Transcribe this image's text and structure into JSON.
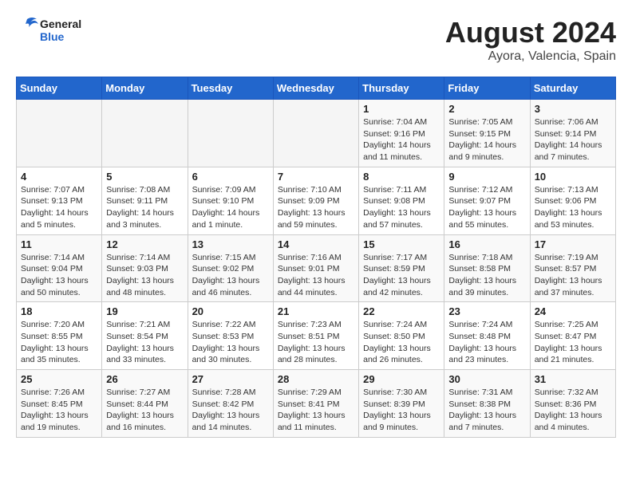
{
  "logo": {
    "line1": "General",
    "line2": "Blue"
  },
  "title": "August 2024",
  "subtitle": "Ayora, Valencia, Spain",
  "weekdays": [
    "Sunday",
    "Monday",
    "Tuesday",
    "Wednesday",
    "Thursday",
    "Friday",
    "Saturday"
  ],
  "weeks": [
    [
      {
        "day": "",
        "info": ""
      },
      {
        "day": "",
        "info": ""
      },
      {
        "day": "",
        "info": ""
      },
      {
        "day": "",
        "info": ""
      },
      {
        "day": "1",
        "info": "Sunrise: 7:04 AM\nSunset: 9:16 PM\nDaylight: 14 hours\nand 11 minutes."
      },
      {
        "day": "2",
        "info": "Sunrise: 7:05 AM\nSunset: 9:15 PM\nDaylight: 14 hours\nand 9 minutes."
      },
      {
        "day": "3",
        "info": "Sunrise: 7:06 AM\nSunset: 9:14 PM\nDaylight: 14 hours\nand 7 minutes."
      }
    ],
    [
      {
        "day": "4",
        "info": "Sunrise: 7:07 AM\nSunset: 9:13 PM\nDaylight: 14 hours\nand 5 minutes."
      },
      {
        "day": "5",
        "info": "Sunrise: 7:08 AM\nSunset: 9:11 PM\nDaylight: 14 hours\nand 3 minutes."
      },
      {
        "day": "6",
        "info": "Sunrise: 7:09 AM\nSunset: 9:10 PM\nDaylight: 14 hours\nand 1 minute."
      },
      {
        "day": "7",
        "info": "Sunrise: 7:10 AM\nSunset: 9:09 PM\nDaylight: 13 hours\nand 59 minutes."
      },
      {
        "day": "8",
        "info": "Sunrise: 7:11 AM\nSunset: 9:08 PM\nDaylight: 13 hours\nand 57 minutes."
      },
      {
        "day": "9",
        "info": "Sunrise: 7:12 AM\nSunset: 9:07 PM\nDaylight: 13 hours\nand 55 minutes."
      },
      {
        "day": "10",
        "info": "Sunrise: 7:13 AM\nSunset: 9:06 PM\nDaylight: 13 hours\nand 53 minutes."
      }
    ],
    [
      {
        "day": "11",
        "info": "Sunrise: 7:14 AM\nSunset: 9:04 PM\nDaylight: 13 hours\nand 50 minutes."
      },
      {
        "day": "12",
        "info": "Sunrise: 7:14 AM\nSunset: 9:03 PM\nDaylight: 13 hours\nand 48 minutes."
      },
      {
        "day": "13",
        "info": "Sunrise: 7:15 AM\nSunset: 9:02 PM\nDaylight: 13 hours\nand 46 minutes."
      },
      {
        "day": "14",
        "info": "Sunrise: 7:16 AM\nSunset: 9:01 PM\nDaylight: 13 hours\nand 44 minutes."
      },
      {
        "day": "15",
        "info": "Sunrise: 7:17 AM\nSunset: 8:59 PM\nDaylight: 13 hours\nand 42 minutes."
      },
      {
        "day": "16",
        "info": "Sunrise: 7:18 AM\nSunset: 8:58 PM\nDaylight: 13 hours\nand 39 minutes."
      },
      {
        "day": "17",
        "info": "Sunrise: 7:19 AM\nSunset: 8:57 PM\nDaylight: 13 hours\nand 37 minutes."
      }
    ],
    [
      {
        "day": "18",
        "info": "Sunrise: 7:20 AM\nSunset: 8:55 PM\nDaylight: 13 hours\nand 35 minutes."
      },
      {
        "day": "19",
        "info": "Sunrise: 7:21 AM\nSunset: 8:54 PM\nDaylight: 13 hours\nand 33 minutes."
      },
      {
        "day": "20",
        "info": "Sunrise: 7:22 AM\nSunset: 8:53 PM\nDaylight: 13 hours\nand 30 minutes."
      },
      {
        "day": "21",
        "info": "Sunrise: 7:23 AM\nSunset: 8:51 PM\nDaylight: 13 hours\nand 28 minutes."
      },
      {
        "day": "22",
        "info": "Sunrise: 7:24 AM\nSunset: 8:50 PM\nDaylight: 13 hours\nand 26 minutes."
      },
      {
        "day": "23",
        "info": "Sunrise: 7:24 AM\nSunset: 8:48 PM\nDaylight: 13 hours\nand 23 minutes."
      },
      {
        "day": "24",
        "info": "Sunrise: 7:25 AM\nSunset: 8:47 PM\nDaylight: 13 hours\nand 21 minutes."
      }
    ],
    [
      {
        "day": "25",
        "info": "Sunrise: 7:26 AM\nSunset: 8:45 PM\nDaylight: 13 hours\nand 19 minutes."
      },
      {
        "day": "26",
        "info": "Sunrise: 7:27 AM\nSunset: 8:44 PM\nDaylight: 13 hours\nand 16 minutes."
      },
      {
        "day": "27",
        "info": "Sunrise: 7:28 AM\nSunset: 8:42 PM\nDaylight: 13 hours\nand 14 minutes."
      },
      {
        "day": "28",
        "info": "Sunrise: 7:29 AM\nSunset: 8:41 PM\nDaylight: 13 hours\nand 11 minutes."
      },
      {
        "day": "29",
        "info": "Sunrise: 7:30 AM\nSunset: 8:39 PM\nDaylight: 13 hours\nand 9 minutes."
      },
      {
        "day": "30",
        "info": "Sunrise: 7:31 AM\nSunset: 8:38 PM\nDaylight: 13 hours\nand 7 minutes."
      },
      {
        "day": "31",
        "info": "Sunrise: 7:32 AM\nSunset: 8:36 PM\nDaylight: 13 hours\nand 4 minutes."
      }
    ]
  ]
}
